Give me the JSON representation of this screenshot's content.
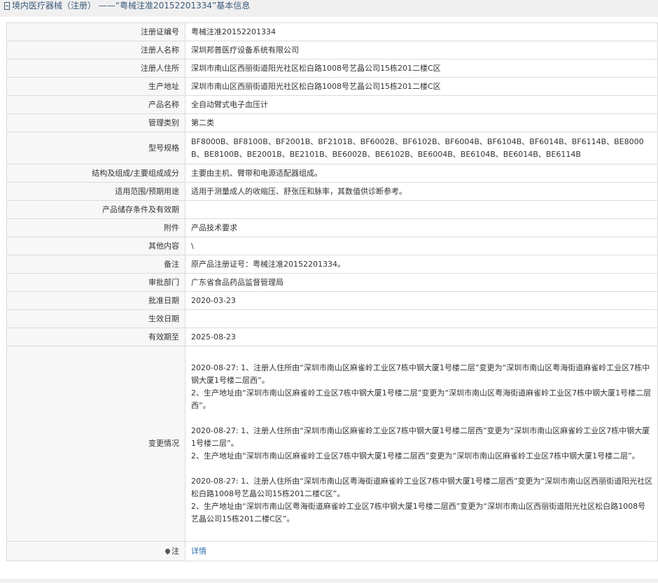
{
  "header": {
    "title": "境内医疗器械（注册） ——“粤械注准20152201334”基本信息"
  },
  "rows": [
    {
      "label": "注册证编号",
      "value": "粤械注准20152201334"
    },
    {
      "label": "注册人名称",
      "value": "深圳邦普医疗设备系统有限公司"
    },
    {
      "label": "注册人住所",
      "value": "深圳市南山区西丽街道阳光社区松白路1008号艺晶公司15栋201二楼C区"
    },
    {
      "label": "生产地址",
      "value": "深圳市南山区西丽街道阳光社区松白路1008号艺晶公司15栋201二楼C区"
    },
    {
      "label": "产品名称",
      "value": "全自动臂式电子血压计"
    },
    {
      "label": "管理类别",
      "value": "第二类"
    },
    {
      "label": "型号规格",
      "value": "BF8000B、BF8100B、BF2001B、BF2101B、BF6002B、BF6102B、BF6004B、BF6104B、BF6014B、BF6114B、BE8000B、BE8100B、BE2001B、BE2101B、BE6002B、BE6102B、BE6004B、BE6104B、BE6014B、BE6114B"
    },
    {
      "label": "结构及组成/主要组成成分",
      "value": "主要由主机、臂带和电源适配器组成。"
    },
    {
      "label": "适用范围/预期用途",
      "value": "适用于测量成人的收缩压、舒张压和脉率，其数值供诊断参考。"
    },
    {
      "label": "产品储存条件及有效期",
      "value": ""
    },
    {
      "label": "附件",
      "value": "产品技术要求"
    },
    {
      "label": "其他内容",
      "value": "\\"
    },
    {
      "label": "备注",
      "value": "原产品注册证号：粤械注准20152201334。"
    },
    {
      "label": "审批部门",
      "value": "广东省食品药品监督管理局"
    },
    {
      "label": "批准日期",
      "value": "2020-03-23"
    },
    {
      "label": "生效日期",
      "value": ""
    },
    {
      "label": "有效期至",
      "value": "2025-08-23"
    }
  ],
  "changes": {
    "label": "变更情况",
    "blocks": [
      [
        "2020-08-27: 1、注册人住所由“深圳市南山区麻雀岭工业区7栋中钢大厦1号楼二层”变更为“深圳市南山区粤海街道麻雀岭工业区7栋中钢大厦1号楼二层西”。",
        "2、生产地址由“深圳市南山区麻雀岭工业区7栋中钢大厦1号楼二层”变更为“深圳市南山区粤海街道麻雀岭工业区7栋中钢大厦1号楼二层西”。"
      ],
      [
        "2020-08-27: 1、注册人住所由“深圳市南山区麻雀岭工业区7栋中钢大厦1号楼二层西”变更为“深圳市南山区麻雀岭工业区7栋中钢大厦1号楼二层”。",
        "2、生产地址由“深圳市南山区麻雀岭工业区7栋中钢大厦1号楼二层西”变更为“深圳市南山区麻雀岭工业区7栋中钢大厦1号楼二层”。"
      ],
      [
        "2020-08-27: 1、注册人住所由“深圳市南山区粤海街道麻雀岭工业区7栋中钢大厦1号楼二层西”变更为“深圳市南山区西丽街道阳光社区松白路1008号艺晶公司15栋201二楼C区”。",
        "2、生产地址由“深圳市南山区粤海街道麻雀岭工业区7栋中钢大厦1号楼二层西”变更为“深圳市南山区西丽街道阳光社区松白路1008号艺晶公司15栋201二楼C区”。"
      ]
    ]
  },
  "note": {
    "label": "注",
    "icon": "pin-icon",
    "link": "详情"
  },
  "colors": {
    "title": "#3d5a7a",
    "link": "#2f6fb0",
    "label_bg": "#f7f7f7",
    "border": "#dcdcdc"
  }
}
